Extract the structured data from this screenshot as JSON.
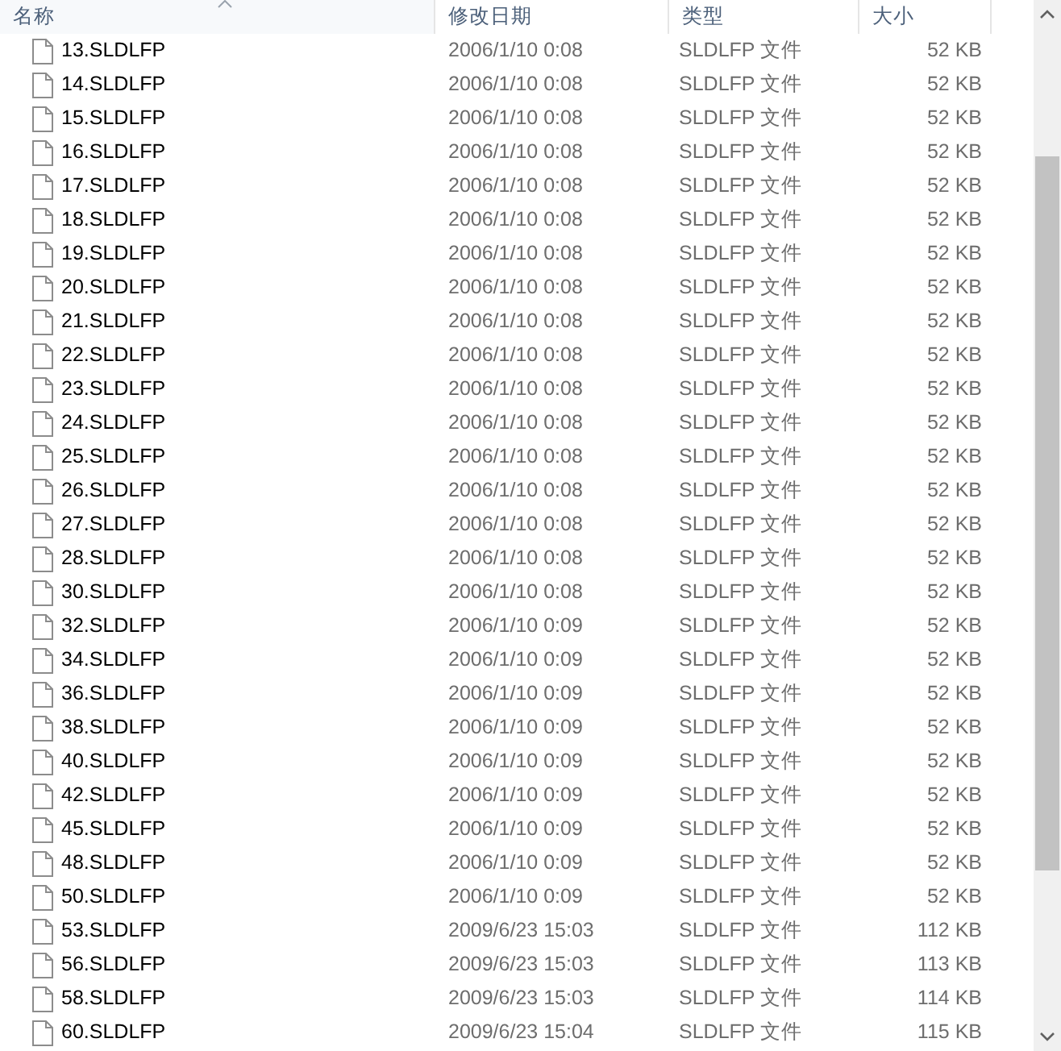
{
  "columns": [
    {
      "label": "名称",
      "sorted": true
    },
    {
      "label": "修改日期",
      "sorted": false
    },
    {
      "label": "类型",
      "sorted": false
    },
    {
      "label": "大小",
      "sorted": false
    }
  ],
  "rows": [
    {
      "name": "13.SLDLFP",
      "modified": "2006/1/10 0:08",
      "type": "SLDLFP 文件",
      "size": "52 KB"
    },
    {
      "name": "14.SLDLFP",
      "modified": "2006/1/10 0:08",
      "type": "SLDLFP 文件",
      "size": "52 KB"
    },
    {
      "name": "15.SLDLFP",
      "modified": "2006/1/10 0:08",
      "type": "SLDLFP 文件",
      "size": "52 KB"
    },
    {
      "name": "16.SLDLFP",
      "modified": "2006/1/10 0:08",
      "type": "SLDLFP 文件",
      "size": "52 KB"
    },
    {
      "name": "17.SLDLFP",
      "modified": "2006/1/10 0:08",
      "type": "SLDLFP 文件",
      "size": "52 KB"
    },
    {
      "name": "18.SLDLFP",
      "modified": "2006/1/10 0:08",
      "type": "SLDLFP 文件",
      "size": "52 KB"
    },
    {
      "name": "19.SLDLFP",
      "modified": "2006/1/10 0:08",
      "type": "SLDLFP 文件",
      "size": "52 KB"
    },
    {
      "name": "20.SLDLFP",
      "modified": "2006/1/10 0:08",
      "type": "SLDLFP 文件",
      "size": "52 KB"
    },
    {
      "name": "21.SLDLFP",
      "modified": "2006/1/10 0:08",
      "type": "SLDLFP 文件",
      "size": "52 KB"
    },
    {
      "name": "22.SLDLFP",
      "modified": "2006/1/10 0:08",
      "type": "SLDLFP 文件",
      "size": "52 KB"
    },
    {
      "name": "23.SLDLFP",
      "modified": "2006/1/10 0:08",
      "type": "SLDLFP 文件",
      "size": "52 KB"
    },
    {
      "name": "24.SLDLFP",
      "modified": "2006/1/10 0:08",
      "type": "SLDLFP 文件",
      "size": "52 KB"
    },
    {
      "name": "25.SLDLFP",
      "modified": "2006/1/10 0:08",
      "type": "SLDLFP 文件",
      "size": "52 KB"
    },
    {
      "name": "26.SLDLFP",
      "modified": "2006/1/10 0:08",
      "type": "SLDLFP 文件",
      "size": "52 KB"
    },
    {
      "name": "27.SLDLFP",
      "modified": "2006/1/10 0:08",
      "type": "SLDLFP 文件",
      "size": "52 KB"
    },
    {
      "name": "28.SLDLFP",
      "modified": "2006/1/10 0:08",
      "type": "SLDLFP 文件",
      "size": "52 KB"
    },
    {
      "name": "30.SLDLFP",
      "modified": "2006/1/10 0:08",
      "type": "SLDLFP 文件",
      "size": "52 KB"
    },
    {
      "name": "32.SLDLFP",
      "modified": "2006/1/10 0:09",
      "type": "SLDLFP 文件",
      "size": "52 KB"
    },
    {
      "name": "34.SLDLFP",
      "modified": "2006/1/10 0:09",
      "type": "SLDLFP 文件",
      "size": "52 KB"
    },
    {
      "name": "36.SLDLFP",
      "modified": "2006/1/10 0:09",
      "type": "SLDLFP 文件",
      "size": "52 KB"
    },
    {
      "name": "38.SLDLFP",
      "modified": "2006/1/10 0:09",
      "type": "SLDLFP 文件",
      "size": "52 KB"
    },
    {
      "name": "40.SLDLFP",
      "modified": "2006/1/10 0:09",
      "type": "SLDLFP 文件",
      "size": "52 KB"
    },
    {
      "name": "42.SLDLFP",
      "modified": "2006/1/10 0:09",
      "type": "SLDLFP 文件",
      "size": "52 KB"
    },
    {
      "name": "45.SLDLFP",
      "modified": "2006/1/10 0:09",
      "type": "SLDLFP 文件",
      "size": "52 KB"
    },
    {
      "name": "48.SLDLFP",
      "modified": "2006/1/10 0:09",
      "type": "SLDLFP 文件",
      "size": "52 KB"
    },
    {
      "name": "50.SLDLFP",
      "modified": "2006/1/10 0:09",
      "type": "SLDLFP 文件",
      "size": "52 KB"
    },
    {
      "name": "53.SLDLFP",
      "modified": "2009/6/23 15:03",
      "type": "SLDLFP 文件",
      "size": "112 KB"
    },
    {
      "name": "56.SLDLFP",
      "modified": "2009/6/23 15:03",
      "type": "SLDLFP 文件",
      "size": "113 KB"
    },
    {
      "name": "58.SLDLFP",
      "modified": "2009/6/23 15:03",
      "type": "SLDLFP 文件",
      "size": "114 KB"
    },
    {
      "name": "60.SLDLFP",
      "modified": "2009/6/23 15:04",
      "type": "SLDLFP 文件",
      "size": "115 KB"
    }
  ]
}
